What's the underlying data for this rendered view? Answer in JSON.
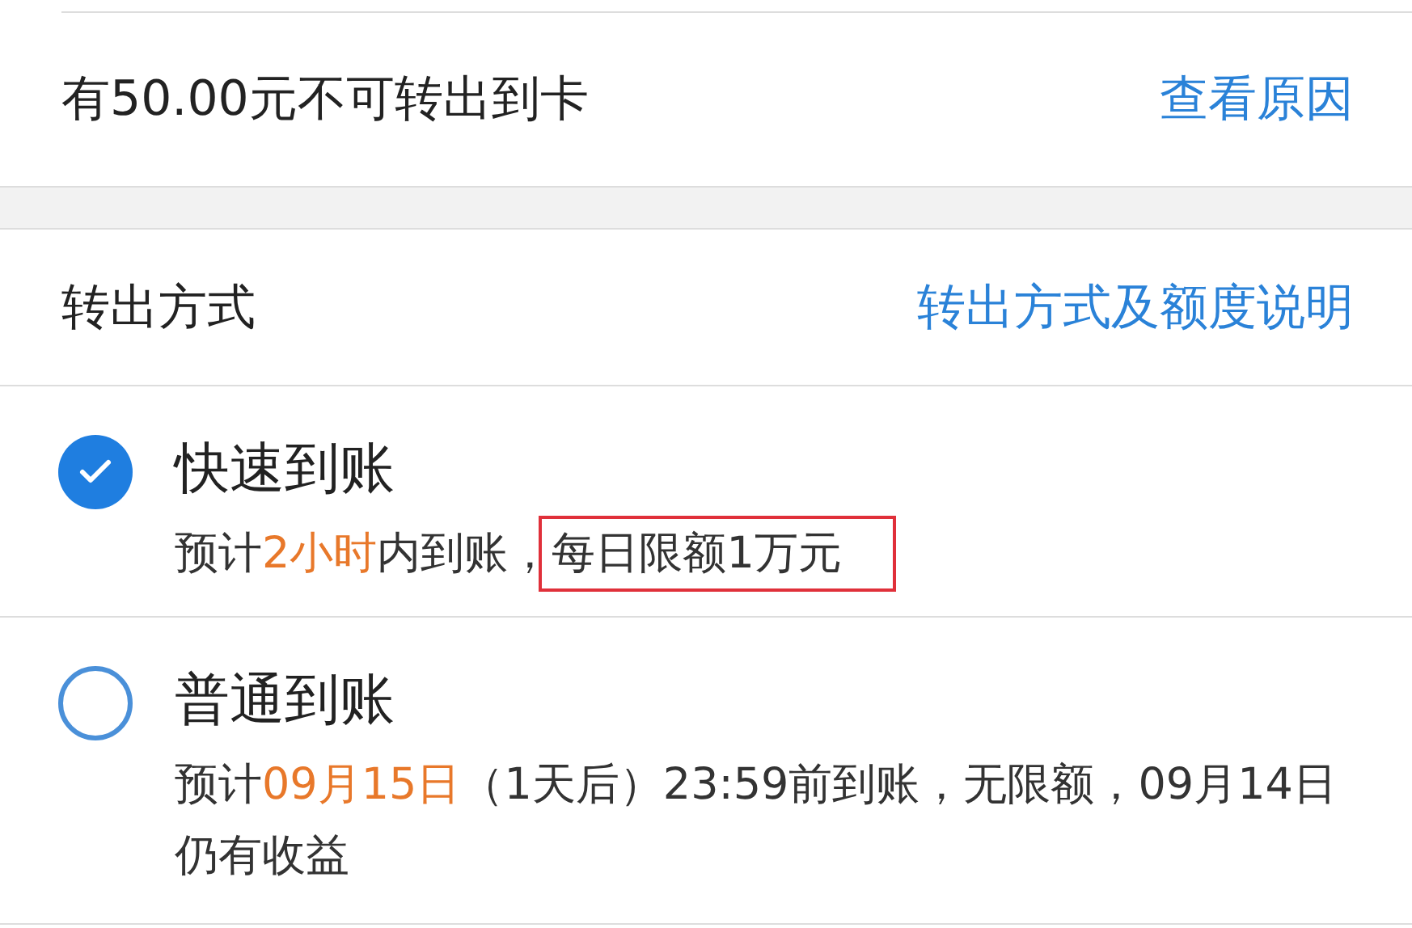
{
  "notice": {
    "text": "有50.00元不可转出到卡",
    "link": "查看原因"
  },
  "method_header": {
    "title": "转出方式",
    "link": "转出方式及额度说明"
  },
  "options": [
    {
      "title": "快速到账",
      "selected": true,
      "description": [
        {
          "text": "预计",
          "kind": "plain"
        },
        {
          "text": "2小时",
          "kind": "highlight"
        },
        {
          "text": "内到账，",
          "kind": "plain"
        },
        {
          "text": "每日限额1万元",
          "kind": "boxed"
        }
      ]
    },
    {
      "title": "普通到账",
      "selected": false,
      "description": [
        {
          "text": "预计",
          "kind": "plain"
        },
        {
          "text": "09月15日",
          "kind": "highlight"
        },
        {
          "text": "（1天后）23:59前到账，无限额，09月14日仍有收益",
          "kind": "plain"
        }
      ]
    }
  ]
}
